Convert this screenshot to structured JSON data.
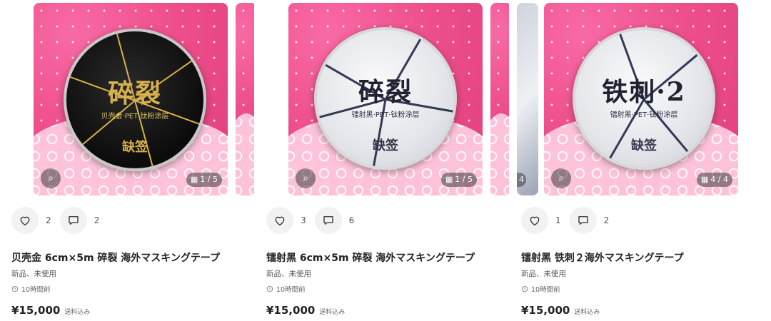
{
  "listings": [
    {
      "title": "贝壳金 6cm×5m 碎裂 海外マスキングテープ",
      "condition": "新品、未使用",
      "time_ago": "10時間前",
      "price": "¥15,000",
      "shipping": "送料込み",
      "likes": "2",
      "comments": "2",
      "image_counter": "1 / 5",
      "tape_title": "碎裂",
      "tape_sub": "贝壳金·PET·钛粉涂层",
      "tape_brand": "缺签"
    },
    {
      "title": "镭射黑 6cm×5m 碎裂 海外マスキングテープ",
      "condition": "新品、未使用",
      "time_ago": "10時間前",
      "price": "¥15,000",
      "shipping": "送料込み",
      "likes": "3",
      "comments": "6",
      "image_counter": "1 / 5",
      "tape_title": "碎裂",
      "tape_sub": "镭射黑·PET·钛粉涂层",
      "tape_brand": "缺签"
    },
    {
      "title": "镭射黑 铁刺２海外マスキングテープ",
      "condition": "新品、未使用",
      "time_ago": "10時間前",
      "price": "¥15,000",
      "shipping": "送料込み",
      "likes": "1",
      "comments": "2",
      "image_counter": "4 / 4",
      "peek_counter": "4",
      "tape_title": "铁刺·2",
      "tape_sub": "镭射黑·PET·钛粉涂层",
      "tape_brand": "缺签"
    }
  ],
  "colors": {
    "photo_bg": "#ee4f8c",
    "text": "#222222",
    "muted": "#666666"
  },
  "icons": {
    "like": "heart-icon",
    "comment": "comment-icon",
    "lens": "image-search-icon",
    "gallery": "grid-icon",
    "time": "clock-icon"
  }
}
